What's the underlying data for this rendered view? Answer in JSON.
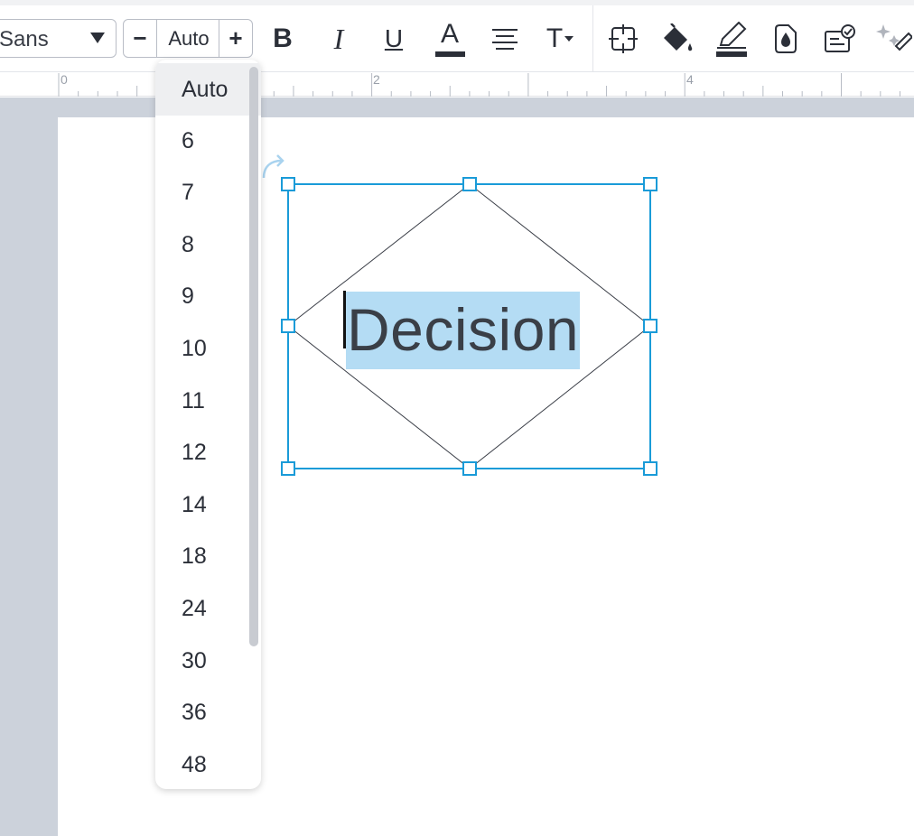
{
  "toolbar": {
    "font_family_value": "Sans",
    "font_size": {
      "decrement_label": "−",
      "value": "Auto",
      "increment_label": "+"
    },
    "buttons": [
      {
        "name": "bold",
        "label": "B"
      },
      {
        "name": "italic",
        "label": "I"
      },
      {
        "name": "underline",
        "label": "U"
      },
      {
        "name": "text-color",
        "label": "A"
      },
      {
        "name": "align",
        "icon": "align-center-icon"
      },
      {
        "name": "text-options",
        "label": "T",
        "icon": "caret-down-icon"
      },
      {
        "name": "arrange",
        "icon": "crosshair-frame-icon"
      },
      {
        "name": "fill",
        "icon": "paint-bucket-icon"
      },
      {
        "name": "line-color",
        "icon": "pencil-icon"
      },
      {
        "name": "opacity",
        "icon": "drop-doc-icon"
      },
      {
        "name": "data",
        "icon": "checklist-icon"
      },
      {
        "name": "ai",
        "icon": "magic-wand-icon"
      }
    ]
  },
  "ruler": {
    "labels": [
      "0",
      "2",
      "4"
    ]
  },
  "shape": {
    "text": "Decision"
  },
  "font_size_dropdown": {
    "selected": "Auto",
    "options": [
      "Auto",
      "6",
      "7",
      "8",
      "9",
      "10",
      "11",
      "12",
      "14",
      "18",
      "24",
      "30",
      "36",
      "48"
    ]
  },
  "colors": {
    "selection": "#1a9bd8",
    "text_highlight": "#b4dcf4",
    "canvas_background": "#ccd2db"
  }
}
